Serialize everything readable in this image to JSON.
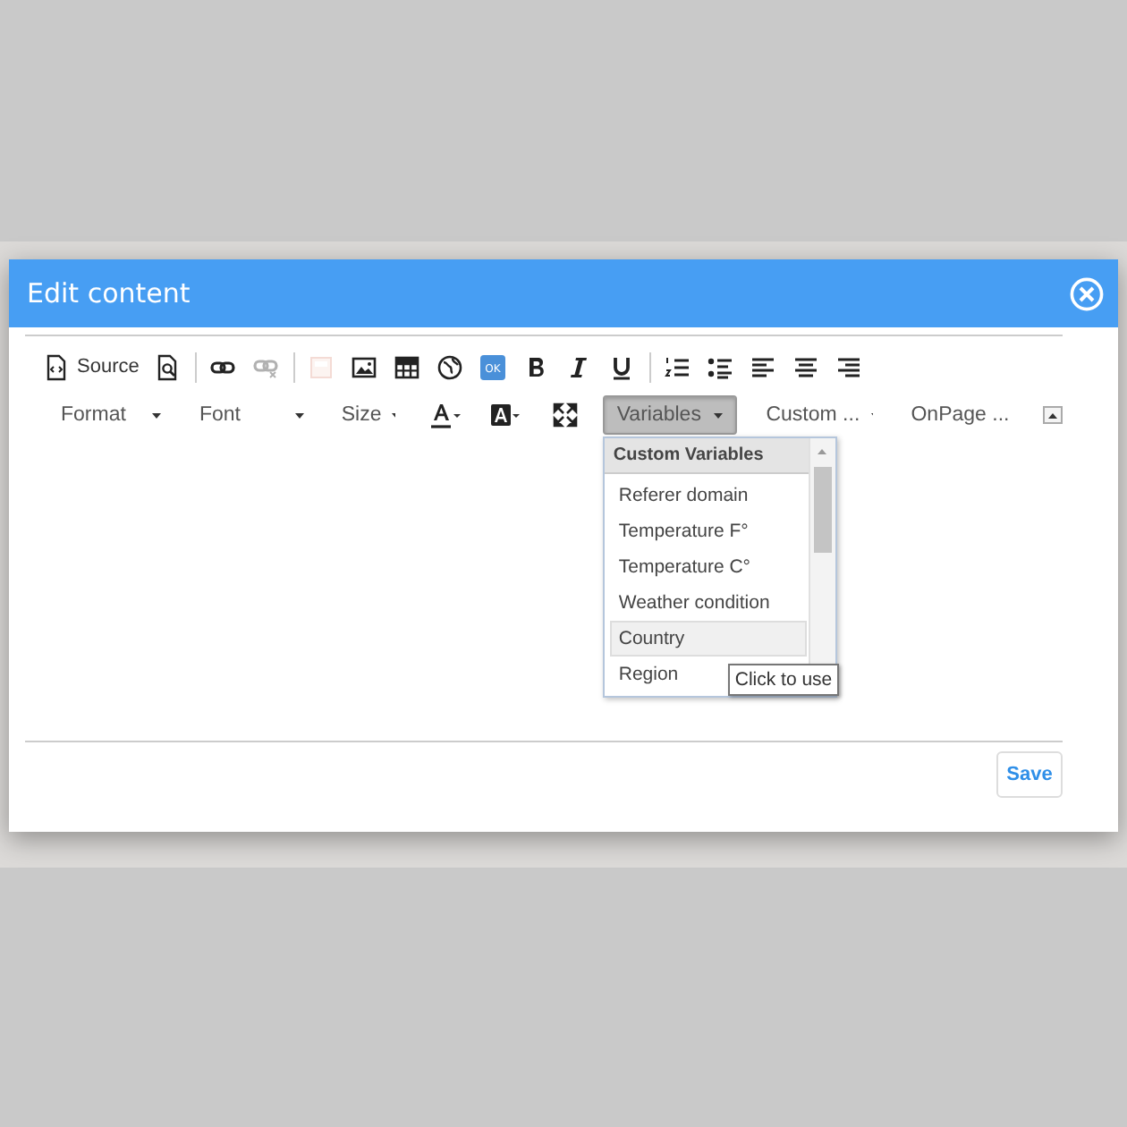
{
  "dialog": {
    "title": "Edit content"
  },
  "toolbar_row_1": {
    "source_label": "Source",
    "ok_label": "OK",
    "buttons": [
      {
        "disabled": false
      },
      {
        "disabled": false
      },
      {
        "disabled": false
      },
      {
        "disabled": true
      },
      {
        "disabled": true
      },
      {
        "disabled": false
      },
      {
        "disabled": false
      },
      {
        "disabled": false
      },
      {
        "disabled": false
      },
      {
        "disabled": false
      },
      {
        "disabled": false
      },
      {
        "disabled": false
      },
      {
        "disabled": false
      },
      {
        "disabled": false
      },
      {
        "disabled": false
      },
      {
        "disabled": false
      },
      {
        "disabled": false
      }
    ]
  },
  "toolbar_row_2": {
    "combos": [
      {
        "label": "Format",
        "expanded": false
      },
      {
        "label": "Font",
        "expanded": false
      },
      {
        "label": "Size",
        "expanded": false
      }
    ],
    "menus": [
      {
        "label": "Variables",
        "expanded": true
      },
      {
        "label": "Custom ...",
        "expanded": false
      },
      {
        "label": "OnPage ...",
        "expanded": false
      }
    ]
  },
  "variables_dropdown": {
    "heading": "Custom Variables",
    "items": [
      {
        "label": "Referer domain",
        "selected": false
      },
      {
        "label": "Temperature F°",
        "selected": false
      },
      {
        "label": "Temperature C°",
        "selected": false
      },
      {
        "label": "Weather condition",
        "selected": false
      },
      {
        "label": "Country",
        "selected": true
      },
      {
        "label": "Region",
        "selected": false
      }
    ],
    "tooltip": "Click to use"
  },
  "footer": {
    "save_label": "Save"
  }
}
